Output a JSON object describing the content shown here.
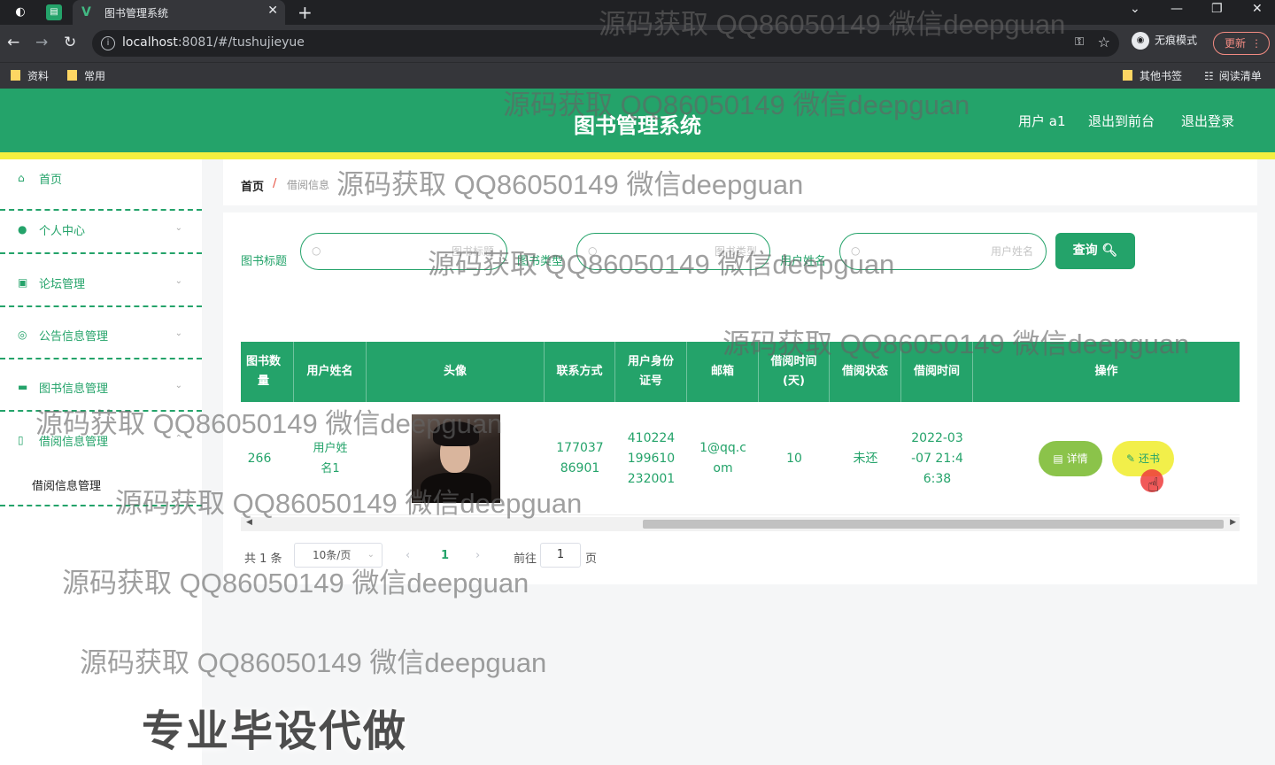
{
  "browser": {
    "tab_title": "图书管理系统",
    "url_host": "localhost",
    "url_rest": ":8081/#/tushujieyue",
    "incognito_label": "无痕模式",
    "update_label": "更新",
    "bookmarks": [
      "资料",
      "常用"
    ],
    "bookmarks_right": [
      "其他书签",
      "阅读清单"
    ]
  },
  "header": {
    "title": "图书管理系统",
    "user": "用户 a1",
    "to_front": "退出到前台",
    "logout": "退出登录"
  },
  "sidebar": {
    "items": [
      {
        "label": "首页"
      },
      {
        "label": "个人中心"
      },
      {
        "label": "论坛管理"
      },
      {
        "label": "公告信息管理"
      },
      {
        "label": "图书信息管理"
      },
      {
        "label": "借阅信息管理"
      }
    ],
    "sub_item": "借阅信息管理"
  },
  "breadcrumb": {
    "home": "首页",
    "sep": "/",
    "current": "借阅信息"
  },
  "search": {
    "book_title_label": "图书标题",
    "book_title_placeholder": "图书标题",
    "book_type_label": "图书类型",
    "book_type_placeholder": "图书类型",
    "user_name_label": "用户姓名",
    "user_name_placeholder": "用户姓名",
    "query_label": "查询"
  },
  "table": {
    "headers": {
      "book_count": "图书数量",
      "user_name": "用户姓名",
      "avatar": "头像",
      "contact": "联系方式",
      "id_line1": "用户身份",
      "id_line2": "证号",
      "email": "邮箱",
      "days_line1": "借阅时间",
      "days_line2": "(天)",
      "status": "借阅状态",
      "borrow_time": "借阅时间",
      "actions": "操作"
    },
    "rows": [
      {
        "book_count": "266",
        "user_name": "用户姓名1",
        "contact": "17703786901",
        "id_number": "410224199610232001",
        "email": "1@qq.com",
        "days": "10",
        "status": "未还",
        "borrow_time": "2022-03-07 21:46:38"
      }
    ],
    "detail_label": "详情",
    "return_label": "还书"
  },
  "pager": {
    "total": "共 1 条",
    "page_size": "10条/页",
    "current_page": "1",
    "goto": "前往",
    "goto_value": "1",
    "page_unit": "页"
  },
  "overlay": {
    "watermark": "源码获取 QQ86050149 微信deepguan",
    "promo": "专业毕设代做"
  }
}
